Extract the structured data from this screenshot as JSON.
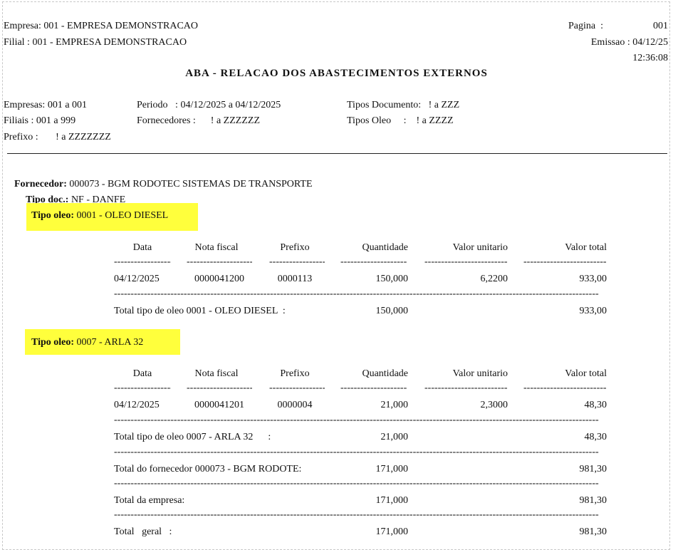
{
  "header": {
    "empresa": "Empresa: 001 - EMPRESA DEMONSTRACAO",
    "filial": "Filial : 001 - EMPRESA DEMONSTRACAO",
    "pagina_label": "Pagina  :",
    "pagina_value": "001",
    "emissao": "Emissao : 04/12/25",
    "hora": "12:36:08",
    "title": "ABA - RELACAO DOS ABASTECIMENTOS EXTERNOS"
  },
  "params": {
    "empresas": "Empresas: 001 a 001",
    "periodo": "Periodo   : 04/12/2025 a 04/12/2025",
    "tipos_documento": "Tipos Documento:   ! a ZZZ",
    "filiais": "Filiais : 001 a 999",
    "fornecedores": "Fornecedores :      ! a ZZZZZZ",
    "tipos_oleo": "Tipos Oleo     :    ! a ZZZZ",
    "prefixo": "Prefixo :       ! a ZZZZZZZ"
  },
  "fornecedor": {
    "label": "Fornecedor:",
    "value": " 000073 - BGM RODOTEC SISTEMAS DE TRANSPORTE",
    "tipo_doc_label": "Tipo doc.:",
    "tipo_doc_value": " NF - DANFE"
  },
  "columns": {
    "data": "Data",
    "nota": "Nota fiscal",
    "prefixo": "Prefixo",
    "quantidade": "Quantidade",
    "valor_unit": "Valor unitario",
    "valor_total": "Valor total"
  },
  "sections": [
    {
      "tipo_label": "Tipo oleo:",
      "tipo_value": " 0001 - OLEO DIESEL",
      "row": {
        "data": "04/12/2025",
        "nota": "0000041200",
        "prefixo": "0000113",
        "quantidade": "150,000",
        "valor_unit": "6,2200",
        "valor_total": "933,00"
      },
      "total_label": "Total tipo de oleo 0001 - OLEO DIESEL  :",
      "total_qtd": "150,000",
      "total_valor": "933,00"
    },
    {
      "tipo_label": "Tipo oleo:",
      "tipo_value": " 0007 - ARLA 32",
      "row": {
        "data": "04/12/2025",
        "nota": "0000041201",
        "prefixo": "0000004",
        "quantidade": "21,000",
        "valor_unit": "2,3000",
        "valor_total": "48,30"
      },
      "total_label": "Total tipo de oleo 0007 - ARLA 32      :",
      "total_qtd": "21,000",
      "total_valor": "48,30"
    }
  ],
  "totals": {
    "fornecedor_label": "Total do fornecedor 000073 - BGM RODOTE:",
    "fornecedor_qtd": "171,000",
    "fornecedor_valor": "981,30",
    "empresa_label": "Total da empresa:",
    "empresa_qtd": "171,000",
    "empresa_valor": "981,30",
    "geral_label": "Total   geral   :",
    "geral_qtd": "171,000",
    "geral_valor": "981,30"
  }
}
